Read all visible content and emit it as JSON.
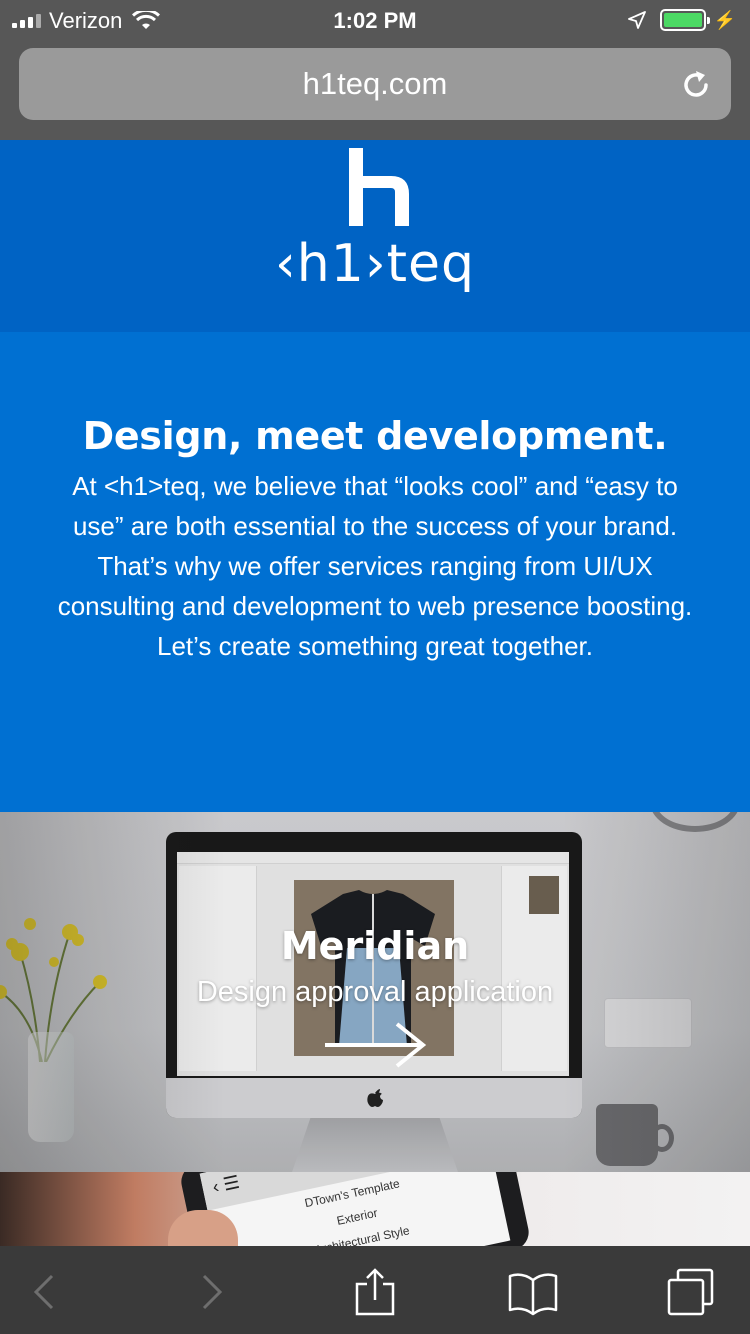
{
  "status_bar": {
    "carrier": "Verizon",
    "time": "1:02 PM",
    "battery_level": 1.0
  },
  "browser": {
    "url": "h1teq.com"
  },
  "header": {
    "logo_text": "‹h1›teq"
  },
  "hero": {
    "title": "Design, meet development.",
    "body": "At <h1>teq, we believe that “looks cool” and “easy to use” are both essential to the success of your brand. That’s why we offer services ranging from UI/UX consulting and development to web presence boosting. Let’s create something great together."
  },
  "projects": [
    {
      "title": "Meridian",
      "subtitle": "Design approval application"
    }
  ],
  "next_project_preview": {
    "menu_icon": "‹ ☰",
    "items": [
      "DTown's Template",
      "Exterior",
      "Architectural Style"
    ]
  },
  "colors": {
    "header_blue": "#0063c4",
    "hero_blue": "#0070d2",
    "battery_green": "#4cd964",
    "toolbar": "#3a3a3a"
  },
  "icons": {
    "status": [
      "signal-icon",
      "wifi-icon",
      "location-icon",
      "battery-icon",
      "charging-icon"
    ],
    "url_bar": [
      "reload-icon"
    ],
    "toolbar": [
      "back-icon",
      "forward-icon",
      "share-icon",
      "bookmarks-icon",
      "tabs-icon"
    ]
  }
}
